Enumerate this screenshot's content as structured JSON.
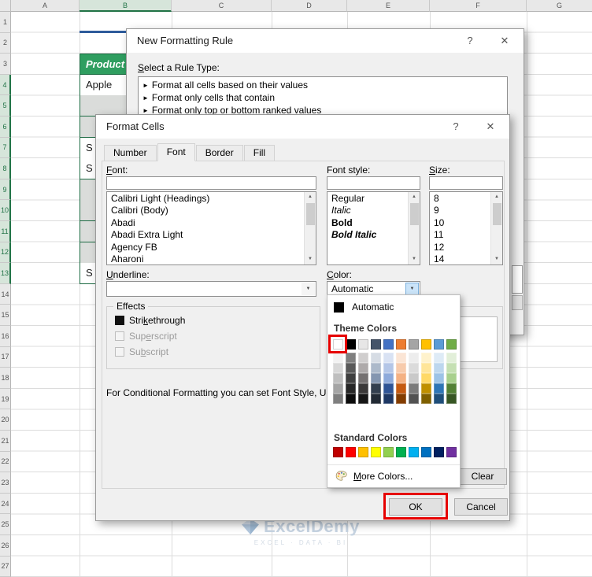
{
  "icons": {
    "help": "?",
    "close": "✕",
    "dropdown_arrow": "▼",
    "scroll_up": "▲",
    "scroll_down": "▼",
    "rule_bullet": "►"
  },
  "excel": {
    "column_headers": [
      "A",
      "B",
      "C",
      "D",
      "E",
      "F",
      "G"
    ],
    "row_count": 27,
    "selected_columns": [
      "B"
    ],
    "selected_rows_start": 4,
    "selected_rows_end": 13,
    "cells": {
      "product_header": "Product"
    },
    "b_fragments": [
      {
        "row": 4,
        "text": "Apple",
        "filled": false
      },
      {
        "row": 5,
        "text": "",
        "filled": true
      },
      {
        "row": 6,
        "text": "",
        "filled": true
      },
      {
        "row": 7,
        "text": "S",
        "filled": false
      },
      {
        "row": 8,
        "text": "S",
        "filled": false
      },
      {
        "row": 9,
        "text": "",
        "filled": true
      },
      {
        "row": 10,
        "text": "",
        "filled": true
      },
      {
        "row": 11,
        "text": "",
        "filled": true
      },
      {
        "row": 12,
        "text": "",
        "filled": true
      },
      {
        "row": 13,
        "text": "S",
        "filled": false
      }
    ],
    "colors": {
      "table_border_green": "#1d6b43",
      "header_fill_green": "#2f9e60",
      "title_underline_blue": "#2e5b9b",
      "selection_tint": "#d6e5da",
      "selection_text": "#217346"
    }
  },
  "watermark": {
    "brand": "ExcelDemy",
    "tagline": "EXCEL · DATA · BI"
  },
  "new_formatting_rule": {
    "title": "New Formatting Rule",
    "select_rule_label": [
      "",
      "S",
      "elect a Rule Type:"
    ],
    "rule_types": [
      "Format all cells based on their values",
      "Format only cells that contain",
      "Format only top or bottom ranked values"
    ]
  },
  "format_cells": {
    "title": "Format Cells",
    "tabs": [
      "Number",
      "Font",
      "Border",
      "Fill"
    ],
    "active_tab": "Font",
    "font_label": [
      "",
      "F",
      "ont:"
    ],
    "font_list": [
      "Calibri Light (Headings)",
      "Calibri (Body)",
      "Abadi",
      "Abadi Extra Light",
      "Agency FB",
      "Aharoni"
    ],
    "font_style_label": [
      "Font style:",
      "",
      ""
    ],
    "font_style_list": [
      {
        "label": "Regular",
        "class": ""
      },
      {
        "label": "Italic",
        "class": "it"
      },
      {
        "label": "Bold",
        "class": "bd"
      },
      {
        "label": "Bold Italic",
        "class": "bi"
      }
    ],
    "size_label": [
      "",
      "S",
      "ize:"
    ],
    "size_list": [
      "8",
      "9",
      "10",
      "11",
      "12",
      "14"
    ],
    "underline_label": [
      "",
      "U",
      "nderline:"
    ],
    "color_label": [
      "",
      "C",
      "olor:"
    ],
    "color_value": "Automatic",
    "effects_label": "Effects",
    "effects": [
      {
        "label": [
          "Stri",
          "k",
          "ethrough"
        ],
        "checked": true,
        "disabled": false
      },
      {
        "label": [
          "Sup",
          "e",
          "rscript"
        ],
        "checked": false,
        "disabled": true
      },
      {
        "label": [
          "Su",
          "b",
          "script"
        ],
        "checked": false,
        "disabled": true
      }
    ],
    "note": "For Conditional Formatting you can set Font Style, Un",
    "clear_button": "Clear",
    "ok_button": "OK",
    "cancel_button": "Cancel"
  },
  "color_picker": {
    "automatic_label": "Automatic",
    "automatic_swatch": "#000000",
    "theme_colors_label": "Theme Colors",
    "standard_colors_label": "Standard Colors",
    "more_colors_label": [
      "",
      "M",
      "ore Colors..."
    ],
    "theme_columns": [
      {
        "base": "#FFFFFF",
        "tints": [
          "#F2F2F2",
          "#D8D8D8",
          "#BFBFBF",
          "#A5A5A5",
          "#7F7F7F"
        ]
      },
      {
        "base": "#000000",
        "tints": [
          "#7F7F7F",
          "#595959",
          "#3F3F3F",
          "#262626",
          "#0C0C0C"
        ]
      },
      {
        "base": "#E7E6E6",
        "tints": [
          "#D0CECE",
          "#AEAAAA",
          "#757171",
          "#3A3838",
          "#161616"
        ]
      },
      {
        "base": "#44546A",
        "tints": [
          "#D6DCE4",
          "#ACB9CA",
          "#8496B0",
          "#333F4F",
          "#222A35"
        ]
      },
      {
        "base": "#4472C4",
        "tints": [
          "#D9E2F3",
          "#B4C6E7",
          "#8EAADB",
          "#2F5496",
          "#1F3864"
        ]
      },
      {
        "base": "#ED7D31",
        "tints": [
          "#FBE5D5",
          "#F7CBAC",
          "#F4B183",
          "#C55A11",
          "#833C00"
        ]
      },
      {
        "base": "#A5A5A5",
        "tints": [
          "#EDEDED",
          "#DBDBDB",
          "#C9C9C9",
          "#7B7B7B",
          "#525252"
        ]
      },
      {
        "base": "#FFC000",
        "tints": [
          "#FFF2CC",
          "#FFE599",
          "#FFD966",
          "#BF9000",
          "#7F6000"
        ]
      },
      {
        "base": "#5B9BD5",
        "tints": [
          "#DEEBF6",
          "#BDD7EE",
          "#9DC3E6",
          "#2E75B5",
          "#1F4E79"
        ]
      },
      {
        "base": "#70AD47",
        "tints": [
          "#E2EFD9",
          "#C5E0B3",
          "#A8D08D",
          "#538135",
          "#375623"
        ]
      }
    ],
    "standard_colors": [
      "#C00000",
      "#FF0000",
      "#FFC000",
      "#FFFF00",
      "#92D050",
      "#00B050",
      "#00B0F0",
      "#0070C0",
      "#002060",
      "#7030A0"
    ],
    "annotation_red": "#E60000"
  }
}
